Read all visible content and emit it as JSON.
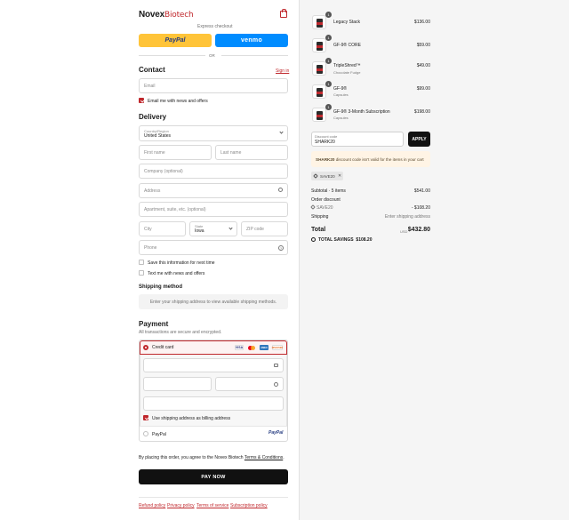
{
  "brand": {
    "name_bold": "Novex",
    "name_light": "Biotech"
  },
  "express": {
    "label": "Express checkout",
    "paypal_label": "PayPal",
    "venmo_label": "venmo",
    "or_label": "OR"
  },
  "contact": {
    "heading": "Contact",
    "sign_in": "Sign in",
    "email_placeholder": "Email",
    "email_news_label": "Email me with news and offers"
  },
  "delivery": {
    "heading": "Delivery",
    "country_label": "Country/Region",
    "country_value": "United States",
    "first_name": "First name",
    "last_name": "Last name",
    "company": "Company (optional)",
    "address": "Address",
    "apartment": "Apartment, suite, etc. (optional)",
    "city": "City",
    "state_label": "State",
    "state_value": "Iowa",
    "zip": "ZIP code",
    "phone": "Phone",
    "save_info": "Save this information for next time",
    "text_me": "Text me with news and offers"
  },
  "shipping": {
    "heading": "Shipping method",
    "message": "Enter your shipping address to view available shipping methods."
  },
  "payment": {
    "heading": "Payment",
    "subtitle": "All transactions are secure and encrypted.",
    "credit_card_label": "Credit card",
    "card_logos": [
      "VISA",
      "MC",
      "AMEX",
      "DISCOVER"
    ],
    "billing_same": "Use shipping address as billing address",
    "paypal_option": "PayPal",
    "paypal_logo": "PayPal"
  },
  "legal": {
    "agree_prefix": "By placing this order, you agree to the Novex Biotech",
    "terms_link": "Terms & Conditions",
    "agree_suffix": "."
  },
  "pay_now": "PAY NOW",
  "footer_links": [
    "Refund policy",
    "Privacy policy",
    "Terms of service",
    "Subscription policy"
  ],
  "cart": {
    "items": [
      {
        "qty": "1",
        "name": "Legacy Stack",
        "variant": "",
        "price": "$136.00"
      },
      {
        "qty": "1",
        "name": "GF-9® CORE",
        "variant": "",
        "price": "$59.00"
      },
      {
        "qty": "1",
        "name": "TripleShred™",
        "variant": "Chocolate Fudge",
        "price": "$49.00"
      },
      {
        "qty": "1",
        "name": "GF-9®",
        "variant": "Capsules",
        "price": "$99.00"
      },
      {
        "qty": "1",
        "name": "GF-9® 3-Month Subscription",
        "variant": "Capsules",
        "price": "$198.00"
      }
    ],
    "discount_label": "Discount code",
    "discount_value": "SHARK20",
    "apply_label": "APPLY",
    "warning_code": "SHARK20",
    "warning_text": "discount code isn't valid for the items in your cart",
    "applied_tag": "SAVE20",
    "subtotal_label": "Subtotal · 5 items",
    "subtotal_value": "$541.00",
    "order_discount_label": "Order discount",
    "discount_code_applied": "SAVE20",
    "discount_amount": "- $108.20",
    "shipping_label": "Shipping",
    "shipping_value": "Enter shipping address",
    "total_label": "Total",
    "currency": "USD",
    "total_value": "$432.80",
    "savings_label": "TOTAL SAVINGS",
    "savings_value": "$108.20"
  },
  "colors": {
    "accent": "#c0282d",
    "paypal": "#ffc439",
    "venmo": "#008cff",
    "dark": "#111111"
  }
}
